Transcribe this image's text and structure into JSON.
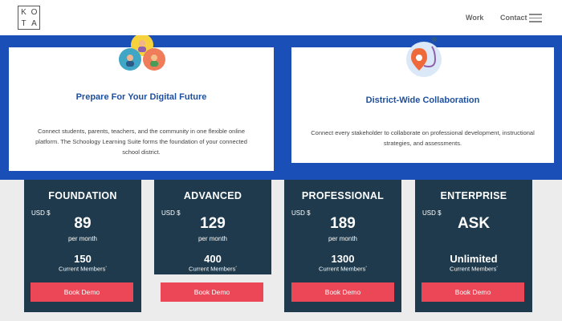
{
  "header": {
    "logo_letters": [
      "K",
      "O",
      "T",
      "A"
    ],
    "nav": {
      "work": "Work",
      "contact": "Contact"
    }
  },
  "cards": [
    {
      "title": "Prepare For Your Digital Future",
      "body": "Connect students, parents, teachers, and the community in one flexible online platform. The Schoology Learning Suite forms the foundation of your connected school district.",
      "icon": "people-group-icon"
    },
    {
      "title": "District-Wide Collaboration",
      "body": "Connect every stakeholder to collaborate on professional development, instructional strategies, and assessments.",
      "icon": "map-pin-route-icon"
    }
  ],
  "plans": [
    {
      "name": "FOUNDATION",
      "currency": "USD $",
      "price": "89",
      "period": "per month",
      "members": "150",
      "members_label": "Current Members",
      "button": "Book Demo"
    },
    {
      "name": "ADVANCED",
      "currency": "USD $",
      "price": "129",
      "period": "per month",
      "members": "400",
      "members_label": "Current Members",
      "button": "Book Demo"
    },
    {
      "name": "PROFESSIONAL",
      "currency": "USD $",
      "price": "189",
      "period": "per month",
      "members": "1300",
      "members_label": "Current Members",
      "button": "Book Demo"
    },
    {
      "name": "ENTERPRISE",
      "currency": "USD $",
      "price": "ASK",
      "period": "",
      "members": "Unlimited",
      "members_label": "Current Members",
      "button": "Book Demo"
    }
  ],
  "colors": {
    "band_blue": "#1a4fb8",
    "plan_bg": "#1e3a4c",
    "button_red": "#ec4757",
    "title_blue": "#1d4f9e"
  }
}
